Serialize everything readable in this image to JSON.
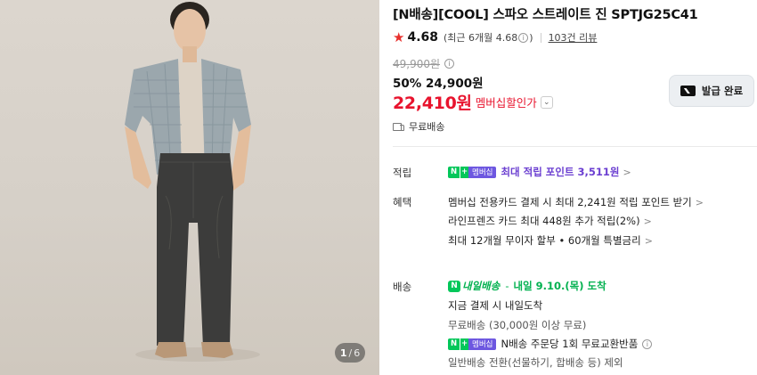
{
  "gallery": {
    "current": "1",
    "separator": "/",
    "total": "6"
  },
  "product": {
    "title": "[N배송][COOL] 스파오 스트레이트 진 SPTJG25C41",
    "rating": "4.68",
    "recent_rating": "(최근 6개월 4.68",
    "recent_rating_close": ")",
    "reviews": "103건 리뷰",
    "original_price": "49,900원",
    "sale_price": "50% 24,900원",
    "member_price": "22,410원",
    "member_price_label": "멤버십할인가",
    "coupon_button": "발급 완료",
    "shipping_fee": "무료배송"
  },
  "points": {
    "label": "적립",
    "badge_n": "N",
    "badge_plus": "+",
    "badge_member": "멤버십",
    "text": "최대 적립 포인트 3,511원"
  },
  "benefits": {
    "label": "혜택",
    "items": [
      "멤버십 전용카드 결제 시 최대 2,241원 적립 포인트 받기",
      "라인프렌즈 카드 최대 448원 추가 적립(2%)",
      "최대 12개월 무이자 할부 • 60개월 특별금리"
    ]
  },
  "delivery": {
    "label": "배송",
    "naeil_badge": "N",
    "naeil_text": "내일배송",
    "arrival": "내일 9.10.(목) 도착",
    "separator": "-",
    "note": "지금 결제 시 내일도착",
    "fee": "무료배송 (30,000원 이상 무료)",
    "exchange": "N배송 주문당 1회 무료교환반품",
    "general": "일반배송 전환(선물하기, 합배송 등) 제외"
  },
  "colors": {
    "member_red": "#e8132d",
    "rating_star": "#e8302d",
    "naver_green": "#03c75a",
    "membership_purple": "#6b3fd1"
  },
  "icons": {
    "star": "star-icon",
    "info": "info-icon",
    "chevron_down": "chevron-down-icon",
    "chevron_right": "chevron-right-icon",
    "truck": "truck-icon",
    "coupon": "coupon-icon"
  }
}
